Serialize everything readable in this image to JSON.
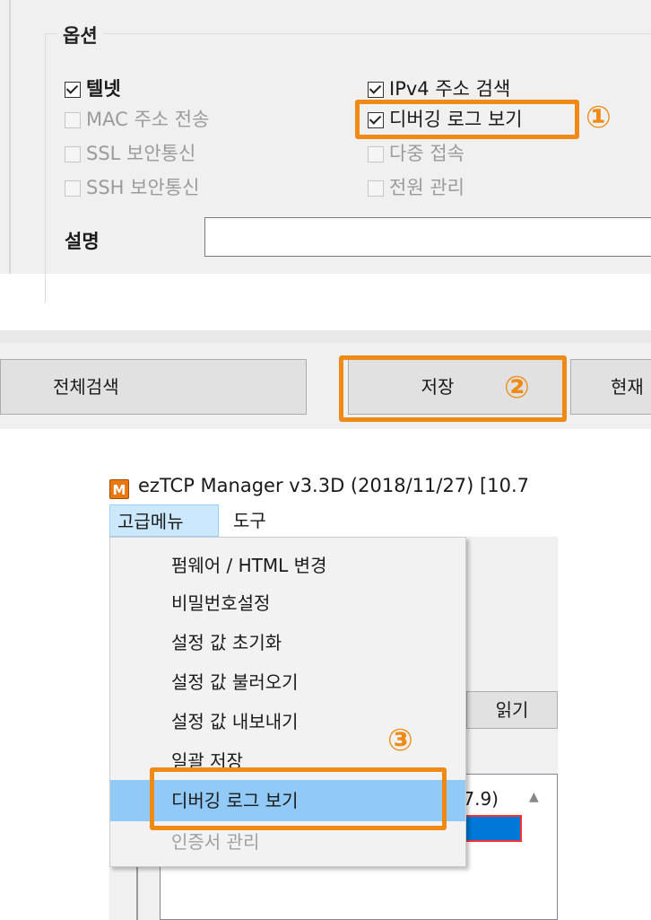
{
  "options_panel": {
    "group_title": "옵션",
    "left_options": [
      {
        "label": "텔넷",
        "checked": true,
        "enabled": true
      },
      {
        "label": "MAC 주소 전송",
        "checked": false,
        "enabled": false
      },
      {
        "label": "SSL 보안통신",
        "checked": false,
        "enabled": false
      },
      {
        "label": "SSH 보안통신",
        "checked": false,
        "enabled": false
      }
    ],
    "right_options": [
      {
        "label": "IPv4 주소 검색",
        "checked": true,
        "enabled": true
      },
      {
        "label": "디버깅 로그 보기",
        "checked": true,
        "enabled": true
      },
      {
        "label": "다중 접속",
        "checked": false,
        "enabled": false
      },
      {
        "label": "전원 관리",
        "checked": false,
        "enabled": false
      }
    ],
    "description_label": "설명",
    "description_value": "",
    "step_badge": "①"
  },
  "toolbar_panel": {
    "search_all_label": "전체검색",
    "save_label": "저장",
    "current_label": "현재",
    "step_badge": "②"
  },
  "app_panel": {
    "window_title": "ezTCP Manager v3.3D (2018/11/27) [10.7",
    "app_icon_letter": "M",
    "menus": [
      "고급메뉴",
      "도구"
    ],
    "dropdown_items": [
      {
        "label": "펌웨어 / HTML 변경",
        "enabled": true
      },
      {
        "label": "비밀번호설정",
        "enabled": true
      },
      {
        "label": "설정 값 초기화",
        "enabled": true
      },
      {
        "label": "설정 값 불러오기",
        "enabled": true
      },
      {
        "label": "설정 값 내보내기",
        "enabled": true
      },
      {
        "label": "일괄 저장",
        "enabled": true
      },
      {
        "label": "디버깅 로그 보기",
        "enabled": true,
        "highlighted": true
      },
      {
        "label": "인증서 관리",
        "enabled": false
      }
    ],
    "background": {
      "read_button": "읽기",
      "list_text": ".7.9)",
      "list_selected_text": ")"
    },
    "step_badge": "③"
  },
  "colors": {
    "highlight": "#f08a16",
    "menu_hover": "#91c9f7",
    "selection": "#0078d7"
  }
}
